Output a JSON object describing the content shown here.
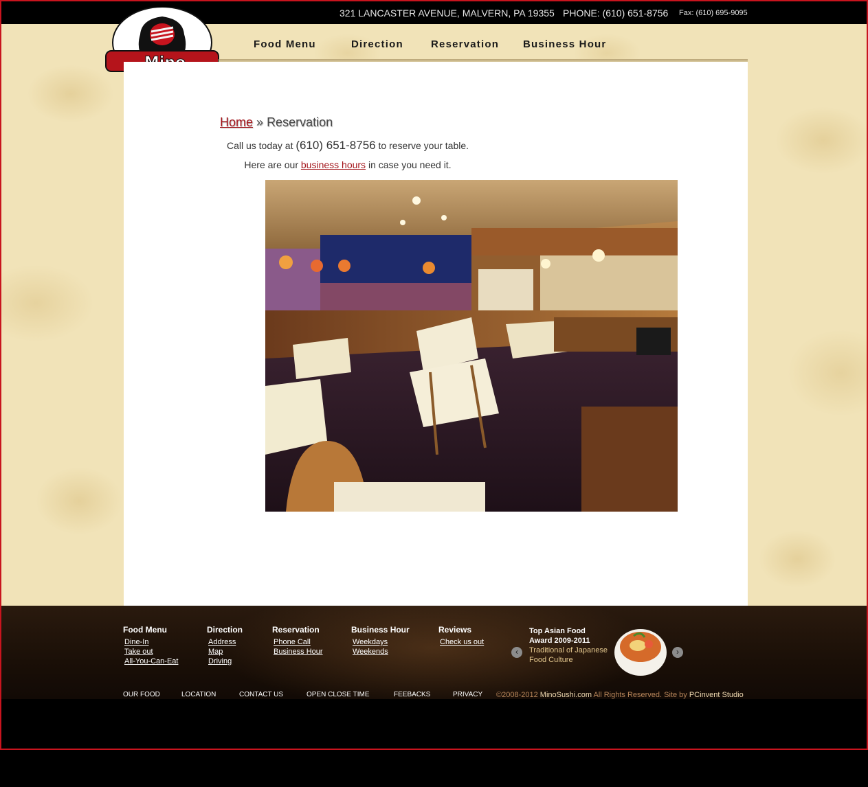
{
  "header": {
    "address": "321 LANCASTER AVENUE, MALVERN, PA 19355",
    "phone": "PHONE: (610) 651-8756",
    "fax": "Fax: (610) 695-9095",
    "logo_text": "Mino",
    "logo_mark": "R"
  },
  "nav": [
    {
      "label": "Food Menu"
    },
    {
      "label": "Direction"
    },
    {
      "label": "Reservation"
    },
    {
      "label": "Business Hour"
    }
  ],
  "breadcrumb": {
    "home": "Home",
    "separator": "»",
    "current": "Reservation"
  },
  "content": {
    "call_prefix": "Call us today at",
    "call_number": "(610) 651-8756",
    "call_suffix": "to reserve your table.",
    "hours_prefix": "Here are our",
    "hours_link": "business hours",
    "hours_suffix": "in case you need it."
  },
  "footer": {
    "columns": [
      {
        "title": "Food Menu",
        "links": [
          "Dine-In",
          "Take out",
          "All-You-Can-Eat"
        ]
      },
      {
        "title": "Direction",
        "links": [
          "Address",
          "Map",
          "Driving"
        ]
      },
      {
        "title": "Reservation",
        "links": [
          "Phone Call",
          "Business Hour"
        ]
      },
      {
        "title": "Business Hour",
        "links": [
          "Weekdays",
          "Weekends"
        ]
      },
      {
        "title": "Reviews",
        "links": [
          "Check us out"
        ]
      }
    ],
    "award": {
      "line1": "Top Asian Food",
      "line2": "Award 2009-2011",
      "line3": "Traditional of Japanese",
      "line4": "Food Culture"
    },
    "prev_arrow": "‹",
    "next_arrow": "›",
    "bottom_links": [
      "OUR FOOD",
      "LOCATION",
      "CONTACT US",
      "OPEN CLOSE TIME",
      "FEEBACKS",
      "PRIVACY"
    ],
    "copyright_prefix": "©2008-2012",
    "copyright_site": "MinoSushi.com",
    "copyright_middle": "All Rights Reserved. Site by",
    "copyright_studio": "PCinvent Studio"
  },
  "colors": {
    "brand_red": "#a3151b",
    "border_red": "#c8141e",
    "paper": "#f1e3b8"
  }
}
